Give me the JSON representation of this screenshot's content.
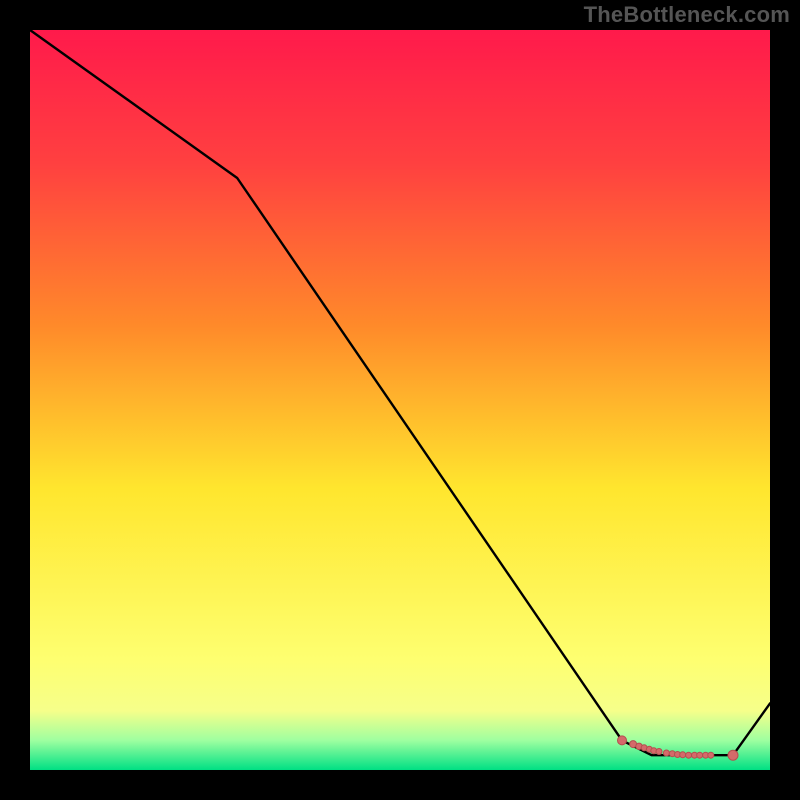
{
  "watermark": "TheBottleneck.com",
  "colors": {
    "background": "#000000",
    "line": "#000000",
    "marker_fill": "#d46a6a",
    "marker_stroke": "#b54f4f",
    "grad_top": "#ff1a4b",
    "grad_mid_upper": "#ff8a2a",
    "grad_mid": "#ffe62e",
    "grad_lower": "#f6ff8a",
    "grad_band": "#9effa0",
    "grad_bottom": "#00e084"
  },
  "chart_data": {
    "type": "line",
    "title": "",
    "xlabel": "",
    "ylabel": "",
    "xlim": [
      0,
      100
    ],
    "ylim": [
      0,
      100
    ],
    "series": [
      {
        "name": "curve",
        "x": [
          0,
          28,
          80,
          84,
          95,
          100
        ],
        "y": [
          100,
          80,
          4,
          2,
          2,
          9
        ]
      }
    ],
    "markers": {
      "name": "highlight-cluster",
      "x": [
        80,
        81.5,
        82.3,
        83,
        83.7,
        84.3,
        85,
        86,
        86.8,
        87.5,
        88.2,
        89,
        89.8,
        90.5,
        91.3,
        92,
        95
      ],
      "y": [
        4,
        3.5,
        3.2,
        3,
        2.8,
        2.6,
        2.5,
        2.3,
        2.2,
        2.1,
        2.05,
        2,
        2,
        2,
        2,
        2,
        2
      ],
      "r": [
        4.5,
        3.5,
        3.2,
        3,
        3,
        3,
        3,
        3,
        3,
        3,
        3,
        3,
        3,
        3,
        3,
        3,
        5
      ]
    }
  }
}
